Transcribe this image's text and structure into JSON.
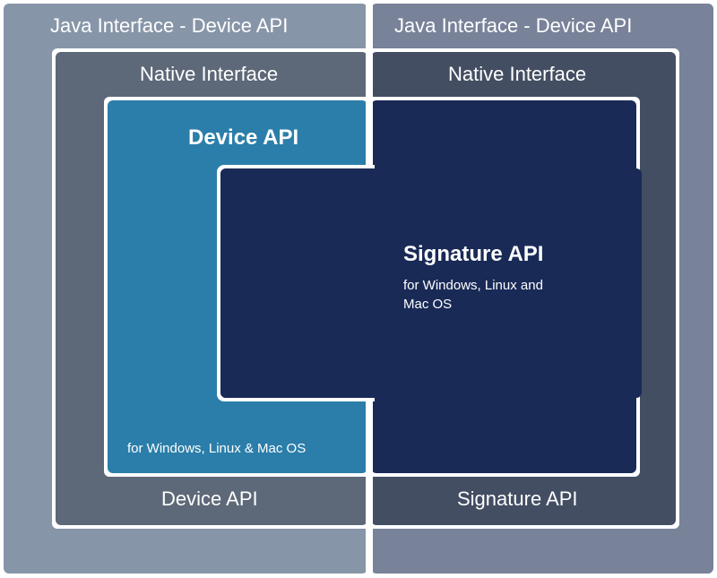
{
  "outer_left": {
    "title": "Java Interface - Device API",
    "bottom_label": "Device API"
  },
  "outer_right": {
    "title": "Java Interface - Device API",
    "bottom_label": "Signature API"
  },
  "native_left": {
    "title": "Native Interface"
  },
  "native_right": {
    "title": "Native Interface"
  },
  "device_api": {
    "title": "Device API",
    "subtitle": "for Windows, Linux & Mac OS"
  },
  "signature_api": {
    "title": "Signature API",
    "subtitle": "for Windows, Linux and Mac OS"
  },
  "colors": {
    "outer_left": "#8795a8",
    "outer_right": "#788299",
    "native_left": "#5d6878",
    "native_right": "#434e62",
    "device": "#2b7ea9",
    "signature": "#1a2a57",
    "gap": "#ffffff"
  }
}
